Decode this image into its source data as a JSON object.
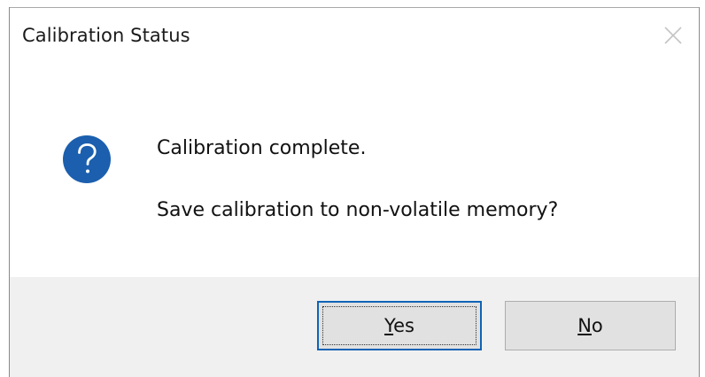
{
  "dialog": {
    "title": "Calibration Status",
    "message_line1": "Calibration complete.",
    "message_line2": "Save calibration to non-volatile memory?",
    "icon": "question-icon",
    "icon_color": "#1b5fae"
  },
  "buttons": {
    "yes": {
      "mnemonic": "Y",
      "rest": "es"
    },
    "no": {
      "mnemonic": "N",
      "rest": "o"
    },
    "default": "yes"
  }
}
